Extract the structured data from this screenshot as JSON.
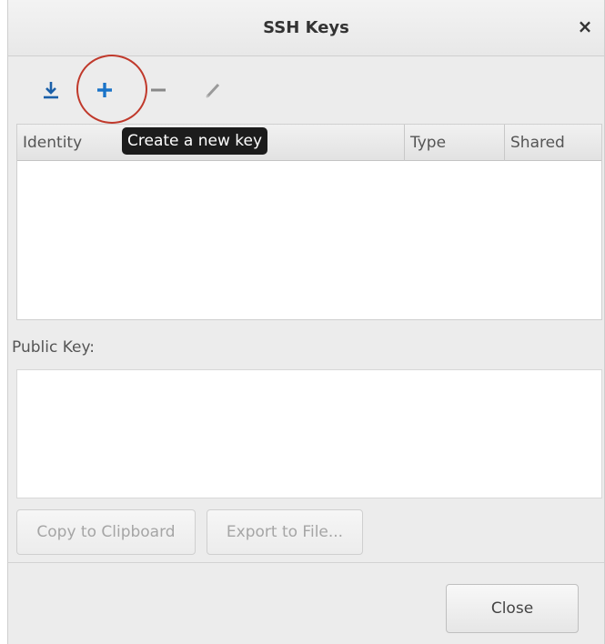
{
  "window": {
    "title": "SSH Keys"
  },
  "toolbar": {
    "import_icon": "download-icon",
    "add_icon": "plus-icon",
    "remove_icon": "minus-icon",
    "edit_icon": "pencil-icon",
    "tooltip": "Create a new key"
  },
  "table": {
    "columns": [
      "Identity",
      "Type",
      "Shared"
    ],
    "rows": []
  },
  "public_key": {
    "label": "Public Key:",
    "value": ""
  },
  "actions": {
    "copy": "Copy to Clipboard",
    "export": "Export to File...",
    "close": "Close"
  },
  "colors": {
    "accent": "#1a73c8",
    "highlight": "#c0392b"
  }
}
